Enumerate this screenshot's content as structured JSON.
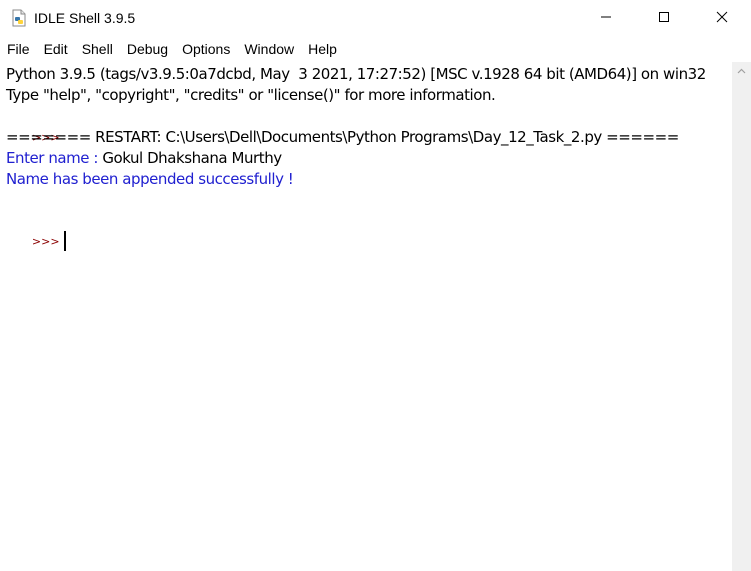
{
  "window": {
    "title": "IDLE Shell 3.9.5",
    "controls": {
      "minimize_icon": "minimize-icon",
      "maximize_icon": "maximize-icon",
      "close_icon": "close-icon"
    }
  },
  "menu": {
    "items": [
      "File",
      "Edit",
      "Shell",
      "Debug",
      "Options",
      "Window",
      "Help"
    ]
  },
  "shell": {
    "banner_line1": "Python 3.9.5 (tags/v3.9.5:0a7dcbd, May  3 2021, 17:27:52) [MSC v.1928 64 bit (AMD64)] on win32",
    "banner_line2": "Type \"help\", \"copyright\", \"credits\" or \"license()\" for more information.",
    "prompt": ">>>",
    "restart_line": "======= RESTART: C:\\Users\\Dell\\Documents\\Python Programs\\Day_12_Task_2.py ======",
    "input_prompt": "Enter name : ",
    "input_value": "Gokul Dhakshana Murthy",
    "result_line": "Name has been appended successfully !"
  },
  "colors": {
    "prompt": "#8b0000",
    "stdout_blue": "#2020d0",
    "text": "#000000",
    "scrollbar": "#f0f0f0"
  }
}
